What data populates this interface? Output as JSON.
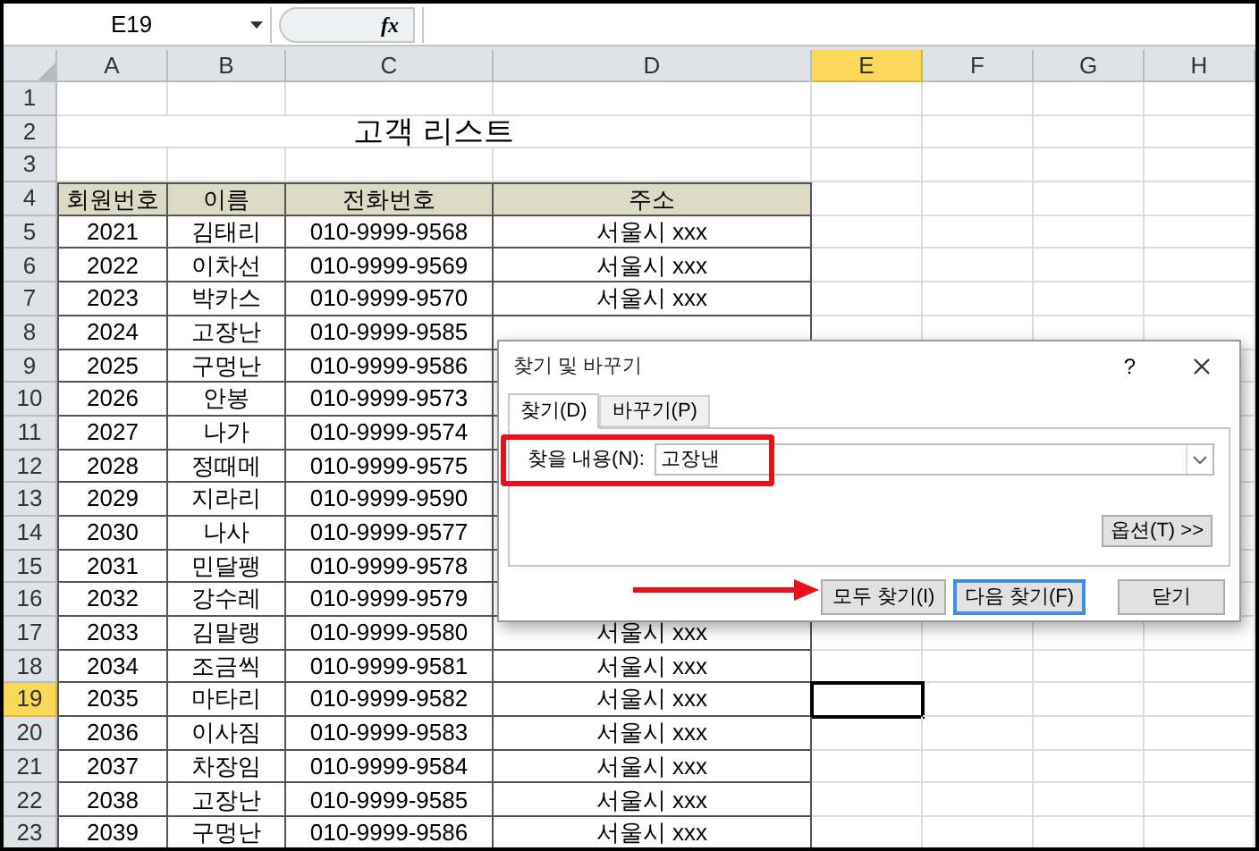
{
  "formula_bar": {
    "name_box": "E19",
    "function_label": "fx"
  },
  "columns": [
    {
      "label": "A",
      "selected": false
    },
    {
      "label": "B",
      "selected": false
    },
    {
      "label": "C",
      "selected": false
    },
    {
      "label": "D",
      "selected": false
    },
    {
      "label": "E",
      "selected": true
    },
    {
      "label": "F",
      "selected": false
    },
    {
      "label": "G",
      "selected": false
    },
    {
      "label": "H",
      "selected": false
    }
  ],
  "row_headers": [
    {
      "label": "1",
      "selected": false
    },
    {
      "label": "2",
      "selected": false
    },
    {
      "label": "3",
      "selected": false
    },
    {
      "label": "4",
      "selected": false
    },
    {
      "label": "5",
      "selected": false
    },
    {
      "label": "6",
      "selected": false
    },
    {
      "label": "7",
      "selected": false
    },
    {
      "label": "8",
      "selected": false
    },
    {
      "label": "9",
      "selected": false
    },
    {
      "label": "10",
      "selected": false
    },
    {
      "label": "11",
      "selected": false
    },
    {
      "label": "12",
      "selected": false
    },
    {
      "label": "13",
      "selected": false
    },
    {
      "label": "14",
      "selected": false
    },
    {
      "label": "15",
      "selected": false
    },
    {
      "label": "16",
      "selected": false
    },
    {
      "label": "17",
      "selected": false
    },
    {
      "label": "18",
      "selected": false
    },
    {
      "label": "19",
      "selected": true
    },
    {
      "label": "20",
      "selected": false
    },
    {
      "label": "21",
      "selected": false
    },
    {
      "label": "22",
      "selected": false
    },
    {
      "label": "23",
      "selected": false
    }
  ],
  "sheet_title": "고객 리스트",
  "table": {
    "headers": [
      "회원번호",
      "이름",
      "전화번호",
      "주소"
    ],
    "rows": [
      {
        "id": "2021",
        "name": "김태리",
        "phone": "010-9999-9568",
        "address": "서울시 xxx"
      },
      {
        "id": "2022",
        "name": "이차선",
        "phone": "010-9999-9569",
        "address": "서울시 xxx"
      },
      {
        "id": "2023",
        "name": "박카스",
        "phone": "010-9999-9570",
        "address": "서울시 xxx"
      },
      {
        "id": "2024",
        "name": "고장난",
        "phone": "010-9999-9585"
      },
      {
        "id": "2025",
        "name": "구멍난",
        "phone": "010-9999-9586"
      },
      {
        "id": "2026",
        "name": "안봉",
        "phone": "010-9999-9573"
      },
      {
        "id": "2027",
        "name": "나가",
        "phone": "010-9999-9574"
      },
      {
        "id": "2028",
        "name": "정때메",
        "phone": "010-9999-9575"
      },
      {
        "id": "2029",
        "name": "지라리",
        "phone": "010-9999-9590"
      },
      {
        "id": "2030",
        "name": "나사",
        "phone": "010-9999-9577"
      },
      {
        "id": "2031",
        "name": "민달팽",
        "phone": "010-9999-9578"
      },
      {
        "id": "2032",
        "name": "강수레",
        "phone": "010-9999-9579"
      },
      {
        "id": "2033",
        "name": "김말랭",
        "phone": "010-9999-9580",
        "address": "서울시 xxx"
      },
      {
        "id": "2034",
        "name": "조금씩",
        "phone": "010-9999-9581",
        "address": "서울시 xxx"
      },
      {
        "id": "2035",
        "name": "마타리",
        "phone": "010-9999-9582",
        "address": "서울시 xxx"
      },
      {
        "id": "2036",
        "name": "이사짐",
        "phone": "010-9999-9583",
        "address": "서울시 xxx"
      },
      {
        "id": "2037",
        "name": "차장임",
        "phone": "010-9999-9584",
        "address": "서울시 xxx"
      },
      {
        "id": "2038",
        "name": "고장난",
        "phone": "010-9999-9585",
        "address": "서울시 xxx"
      },
      {
        "id": "2039",
        "name": "구멍난",
        "phone": "010-9999-9586",
        "address": "서울시 xxx"
      }
    ]
  },
  "dialog": {
    "title": "찾기 및 바꾸기",
    "help": "?",
    "tabs": [
      {
        "label": "찾기(D)",
        "selected": true
      },
      {
        "label": "바꾸기(P)",
        "selected": false
      }
    ],
    "find_label": "찾을 내용(N):",
    "find_value": "고장낸",
    "options_button": "옵션(T) >>",
    "buttons": [
      {
        "label": "모두 찾기(I)",
        "default": false
      },
      {
        "label": "다음 찾기(F)",
        "default": true
      },
      {
        "label": "닫기",
        "default": false
      }
    ]
  }
}
